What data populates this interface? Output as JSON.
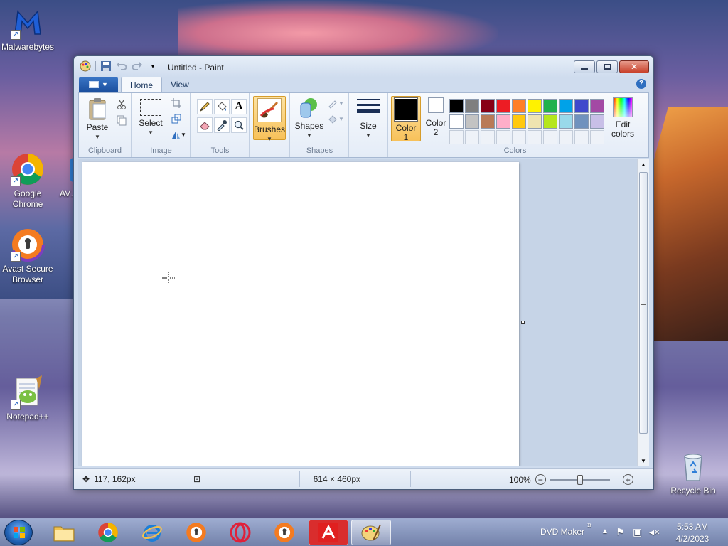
{
  "desktop": {
    "icons": [
      {
        "label": "Malwarebytes"
      },
      {
        "label": "Google Chrome"
      },
      {
        "label": "AV… B…"
      },
      {
        "label": "Avast Secure Browser"
      },
      {
        "label": "Notepad++"
      },
      {
        "label": "Recycle Bin"
      }
    ]
  },
  "window": {
    "title": "Untitled - Paint",
    "tabs": [
      {
        "label": "Home"
      },
      {
        "label": "View"
      }
    ],
    "help": "?"
  },
  "ribbon": {
    "clipboard": {
      "label": "Clipboard",
      "paste": "Paste"
    },
    "image": {
      "label": "Image",
      "select": "Select"
    },
    "tools": {
      "label": "Tools",
      "text_glyph": "A"
    },
    "brushes": "Brushes",
    "shapes": {
      "label": "Shapes",
      "shapes_btn": "Shapes"
    },
    "size": "Size",
    "colors": {
      "label": "Colors",
      "color1": "Color 1",
      "color2": "Color 2",
      "edit": "Edit colors",
      "color1_value": "#000000",
      "color2_value": "#ffffff",
      "row1": [
        "#000000",
        "#7f7f7f",
        "#880015",
        "#ed1c24",
        "#ff7f27",
        "#fff200",
        "#22b14c",
        "#00a2e8",
        "#3f48cc",
        "#a349a4"
      ],
      "row2": [
        "#ffffff",
        "#c3c3c3",
        "#b97a57",
        "#ffaec9",
        "#ffc90e",
        "#efe4b0",
        "#b5e61d",
        "#99d9ea",
        "#7092be",
        "#c8bfe7"
      ]
    }
  },
  "status": {
    "cursor_pos": "117, 162px",
    "canvas_size": "614 × 460px",
    "zoom": "100%",
    "zoom_level": 1.0
  },
  "taskbar": {
    "tray_label": "DVD Maker",
    "time": "5:53 AM",
    "date": "4/2/2023"
  }
}
